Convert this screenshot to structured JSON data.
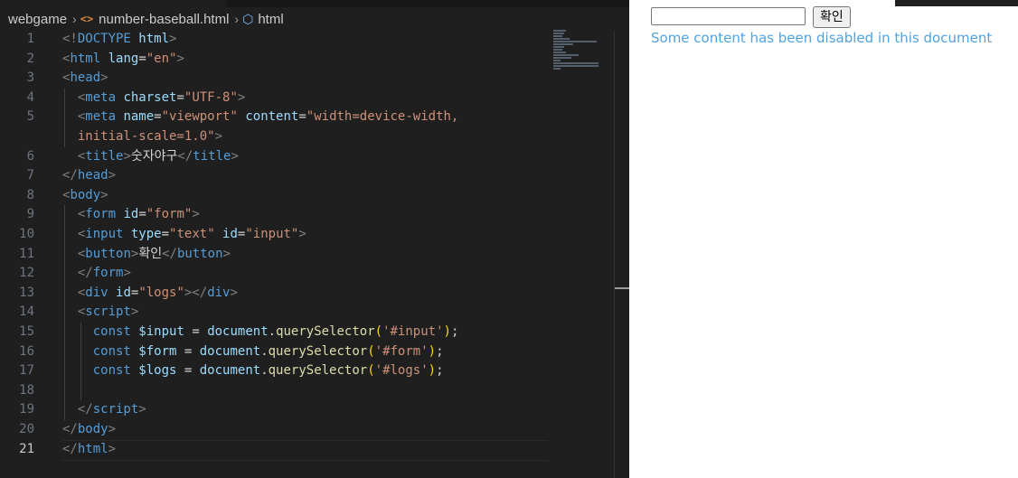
{
  "breadcrumb": {
    "folder": "webgame",
    "file": "number-baseball.html",
    "file_icon": "<>",
    "element": "html"
  },
  "editor": {
    "active_line": "21",
    "lines": [
      {
        "n": "1",
        "t": [
          [
            "tg",
            "<!"
          ],
          [
            "tn",
            "DOCTYPE"
          ],
          [
            "at",
            " html"
          ],
          [
            "tg",
            ">"
          ]
        ]
      },
      {
        "n": "2",
        "t": [
          [
            "tg",
            "<"
          ],
          [
            "tn",
            "html"
          ],
          [
            "at",
            " lang"
          ],
          [
            "tx",
            "="
          ],
          [
            "sv",
            "\"en\""
          ],
          [
            "tg",
            ">"
          ]
        ]
      },
      {
        "n": "3",
        "t": [
          [
            "tg",
            "<"
          ],
          [
            "tn",
            "head"
          ],
          [
            "tg",
            ">"
          ]
        ]
      },
      {
        "n": "4",
        "t": [
          [
            "tx",
            "  "
          ],
          [
            "tg",
            "<"
          ],
          [
            "tn",
            "meta"
          ],
          [
            "at",
            " charset"
          ],
          [
            "tx",
            "="
          ],
          [
            "sv",
            "\"UTF-8\""
          ],
          [
            "tg",
            ">"
          ]
        ]
      },
      {
        "n": "5",
        "t": [
          [
            "tx",
            "  "
          ],
          [
            "tg",
            "<"
          ],
          [
            "tn",
            "meta"
          ],
          [
            "at",
            " name"
          ],
          [
            "tx",
            "="
          ],
          [
            "sv",
            "\"viewport\""
          ],
          [
            "at",
            " content"
          ],
          [
            "tx",
            "="
          ],
          [
            "sv",
            "\"width=device-width,"
          ]
        ]
      },
      {
        "n": "",
        "t": [
          [
            "sv",
            "  initial-scale=1.0\""
          ],
          [
            "tg",
            ">"
          ]
        ]
      },
      {
        "n": "6",
        "t": [
          [
            "tx",
            "  "
          ],
          [
            "tg",
            "<"
          ],
          [
            "tn",
            "title"
          ],
          [
            "tg",
            ">"
          ],
          [
            "tx",
            "숫자야구"
          ],
          [
            "tg",
            "</"
          ],
          [
            "tn",
            "title"
          ],
          [
            "tg",
            ">"
          ]
        ]
      },
      {
        "n": "7",
        "t": [
          [
            "tg",
            "</"
          ],
          [
            "tn",
            "head"
          ],
          [
            "tg",
            ">"
          ]
        ]
      },
      {
        "n": "8",
        "t": [
          [
            "tg",
            "<"
          ],
          [
            "tn",
            "body"
          ],
          [
            "tg",
            ">"
          ]
        ]
      },
      {
        "n": "9",
        "t": [
          [
            "tx",
            "  "
          ],
          [
            "tg",
            "<"
          ],
          [
            "tn",
            "form"
          ],
          [
            "at",
            " id"
          ],
          [
            "tx",
            "="
          ],
          [
            "sv",
            "\"form\""
          ],
          [
            "tg",
            ">"
          ]
        ]
      },
      {
        "n": "10",
        "t": [
          [
            "tx",
            "  "
          ],
          [
            "tg",
            "<"
          ],
          [
            "tn",
            "input"
          ],
          [
            "at",
            " type"
          ],
          [
            "tx",
            "="
          ],
          [
            "sv",
            "\"text\""
          ],
          [
            "at",
            " id"
          ],
          [
            "tx",
            "="
          ],
          [
            "sv",
            "\"input\""
          ],
          [
            "tg",
            ">"
          ]
        ]
      },
      {
        "n": "11",
        "t": [
          [
            "tx",
            "  "
          ],
          [
            "tg",
            "<"
          ],
          [
            "tn",
            "button"
          ],
          [
            "tg",
            ">"
          ],
          [
            "tx",
            "확인"
          ],
          [
            "tg",
            "</"
          ],
          [
            "tn",
            "button"
          ],
          [
            "tg",
            ">"
          ]
        ]
      },
      {
        "n": "12",
        "t": [
          [
            "tx",
            "  "
          ],
          [
            "tg",
            "</"
          ],
          [
            "tn",
            "form"
          ],
          [
            "tg",
            ">"
          ]
        ]
      },
      {
        "n": "13",
        "t": [
          [
            "tx",
            "  "
          ],
          [
            "tg",
            "<"
          ],
          [
            "tn",
            "div"
          ],
          [
            "at",
            " id"
          ],
          [
            "tx",
            "="
          ],
          [
            "sv",
            "\"logs\""
          ],
          [
            "tg",
            "></"
          ],
          [
            "tn",
            "div"
          ],
          [
            "tg",
            ">"
          ]
        ]
      },
      {
        "n": "14",
        "t": [
          [
            "tx",
            "  "
          ],
          [
            "tg",
            "<"
          ],
          [
            "tn",
            "script"
          ],
          [
            "tg",
            ">"
          ]
        ]
      },
      {
        "n": "15",
        "t": [
          [
            "tx",
            "    "
          ],
          [
            "kw",
            "const"
          ],
          [
            "vr",
            " $input"
          ],
          [
            "tx",
            " = "
          ],
          [
            "vr",
            "document"
          ],
          [
            "tx",
            "."
          ],
          [
            "fn",
            "querySelector"
          ],
          [
            "pn",
            "("
          ],
          [
            "sv",
            "'#input'"
          ],
          [
            "pn",
            ")"
          ],
          [
            "tx",
            ";"
          ]
        ]
      },
      {
        "n": "16",
        "t": [
          [
            "tx",
            "    "
          ],
          [
            "kw",
            "const"
          ],
          [
            "vr",
            " $form"
          ],
          [
            "tx",
            " = "
          ],
          [
            "vr",
            "document"
          ],
          [
            "tx",
            "."
          ],
          [
            "fn",
            "querySelector"
          ],
          [
            "pn",
            "("
          ],
          [
            "sv",
            "'#form'"
          ],
          [
            "pn",
            ")"
          ],
          [
            "tx",
            ";"
          ]
        ]
      },
      {
        "n": "17",
        "t": [
          [
            "tx",
            "    "
          ],
          [
            "kw",
            "const"
          ],
          [
            "vr",
            " $logs"
          ],
          [
            "tx",
            " = "
          ],
          [
            "vr",
            "document"
          ],
          [
            "tx",
            "."
          ],
          [
            "fn",
            "querySelector"
          ],
          [
            "pn",
            "("
          ],
          [
            "sv",
            "'#logs'"
          ],
          [
            "pn",
            ")"
          ],
          [
            "tx",
            ";"
          ]
        ]
      },
      {
        "n": "18",
        "t": []
      },
      {
        "n": "19",
        "t": [
          [
            "tx",
            "  "
          ],
          [
            "tg",
            "</"
          ],
          [
            "tn",
            "script"
          ],
          [
            "tg",
            ">"
          ]
        ]
      },
      {
        "n": "20",
        "t": [
          [
            "tg",
            "</"
          ],
          [
            "tn",
            "body"
          ],
          [
            "tg",
            ">"
          ]
        ]
      },
      {
        "n": "21",
        "t": [
          [
            "tg",
            "</"
          ],
          [
            "tn",
            "html"
          ],
          [
            "tg",
            ">"
          ]
        ]
      }
    ]
  },
  "preview": {
    "button_label": "확인",
    "input_value": "",
    "message": "Some content has been disabled in this document"
  }
}
